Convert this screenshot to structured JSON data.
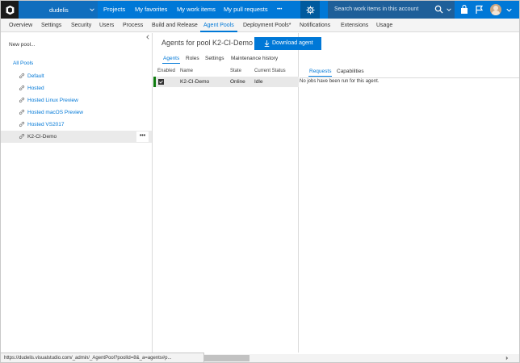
{
  "colors": {
    "brand_blue": "#0078d7",
    "topbar_logo_bg": "#1a1a1a",
    "online_bar": "#107c10",
    "selected_row_bg": "#e8e8e8"
  },
  "topbar": {
    "account": "dudelis",
    "nav": [
      "Projects",
      "My favorites",
      "My work items",
      "My pull requests"
    ],
    "more": "•••",
    "search_placeholder": "Search work items in this account"
  },
  "subnav": {
    "tabs": [
      "Overview",
      "Settings",
      "Security",
      "Users",
      "Process",
      "Build and Release",
      "Agent Pools",
      "Deployment Pools*",
      "Notifications",
      "Extensions",
      "Usage"
    ],
    "active": "Agent Pools"
  },
  "left": {
    "new_pool": "New pool...",
    "all_pools": "All Pools",
    "pools": [
      "Default",
      "Hosted",
      "Hosted Linux Preview",
      "Hosted macOS Preview",
      "Hosted VS2017",
      "K2-CI-Demo"
    ],
    "selected": "K2-CI-Demo",
    "more_label": "•••"
  },
  "main": {
    "title": "Agents for pool K2-CI-Demo",
    "download_button": "Download agent",
    "tabs": [
      "Agents",
      "Roles",
      "Settings",
      "Maintenance history"
    ],
    "active_tab": "Agents",
    "columns": [
      "Enabled",
      "Name",
      "State",
      "Current Status"
    ],
    "rows": [
      {
        "enabled": true,
        "name": "K2-CI-Demo",
        "state": "Online",
        "status": "Idle"
      }
    ]
  },
  "detail": {
    "tabs": [
      "Requests",
      "Capabilities"
    ],
    "active_tab": "Requests",
    "empty_message": "No jobs have been run for this agent."
  },
  "statusbar": {
    "url": "https://dudelis.visualstudio.com/_admin/_AgentPool?poolId=8&_a=agents#p..."
  }
}
